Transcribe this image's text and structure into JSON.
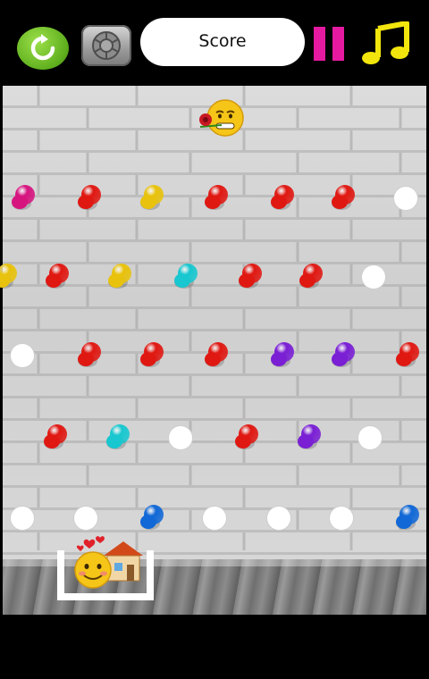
{
  "topbar": {
    "score_label": "Score",
    "icons": {
      "refresh": "refresh-icon",
      "settings": "settings-icon",
      "pause": "pause-icon",
      "music": "music-note-icon"
    }
  },
  "colors": {
    "red": "#e01812",
    "yellow": "#e8c20c",
    "magenta": "#d6157f",
    "cyan": "#18c7cf",
    "purple": "#7a1fd4",
    "blue": "#1168d6",
    "hole": "#ffffff"
  },
  "board": {
    "rows": [
      [
        "magenta",
        "red",
        "yellow",
        "red",
        "red",
        "red",
        "hole"
      ],
      [
        "yellow",
        "red",
        "yellow",
        "cyan",
        "red",
        "red",
        "hole"
      ],
      [
        "hole",
        "red",
        "red",
        "red",
        "purple",
        "purple",
        "red"
      ],
      [
        "red",
        "cyan",
        "hole",
        "red",
        "purple",
        "hole"
      ],
      [
        "hole",
        "hole",
        "blue",
        "hole",
        "hole",
        "hole",
        "blue"
      ]
    ]
  },
  "player": {
    "character": "emoji-with-rose"
  },
  "goal": {
    "character": "emoji-with-house-and-hearts"
  }
}
